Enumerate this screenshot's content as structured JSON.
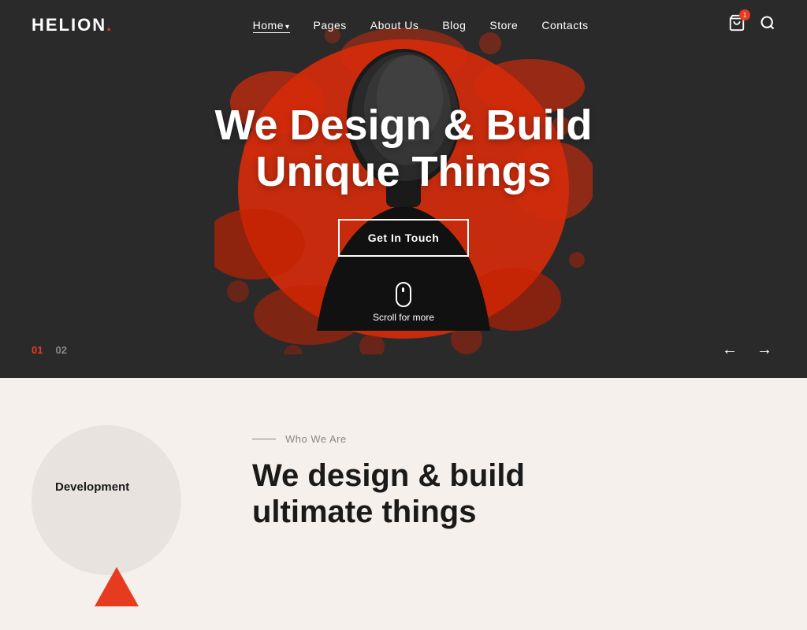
{
  "header": {
    "logo": "HELION",
    "logo_dot": ".",
    "nav": [
      {
        "label": "Home",
        "active": true,
        "has_arrow": true
      },
      {
        "label": "Pages",
        "active": false,
        "has_arrow": false
      },
      {
        "label": "About Us",
        "active": false,
        "has_arrow": false
      },
      {
        "label": "Blog",
        "active": false,
        "has_arrow": false
      },
      {
        "label": "Store",
        "active": false,
        "has_arrow": false
      },
      {
        "label": "Contacts",
        "active": false,
        "has_arrow": false
      }
    ]
  },
  "hero": {
    "title_line1": "We Design & Build",
    "title_line2": "Unique Things",
    "cta_label": "Get In Touch",
    "scroll_label": "Scroll for more",
    "slide_1": "01",
    "slide_2": "02"
  },
  "below": {
    "circle_label": "Development",
    "section_tag": "Who We Are",
    "section_title_line1": "We design & build",
    "section_title_line2": "ultimate things"
  }
}
